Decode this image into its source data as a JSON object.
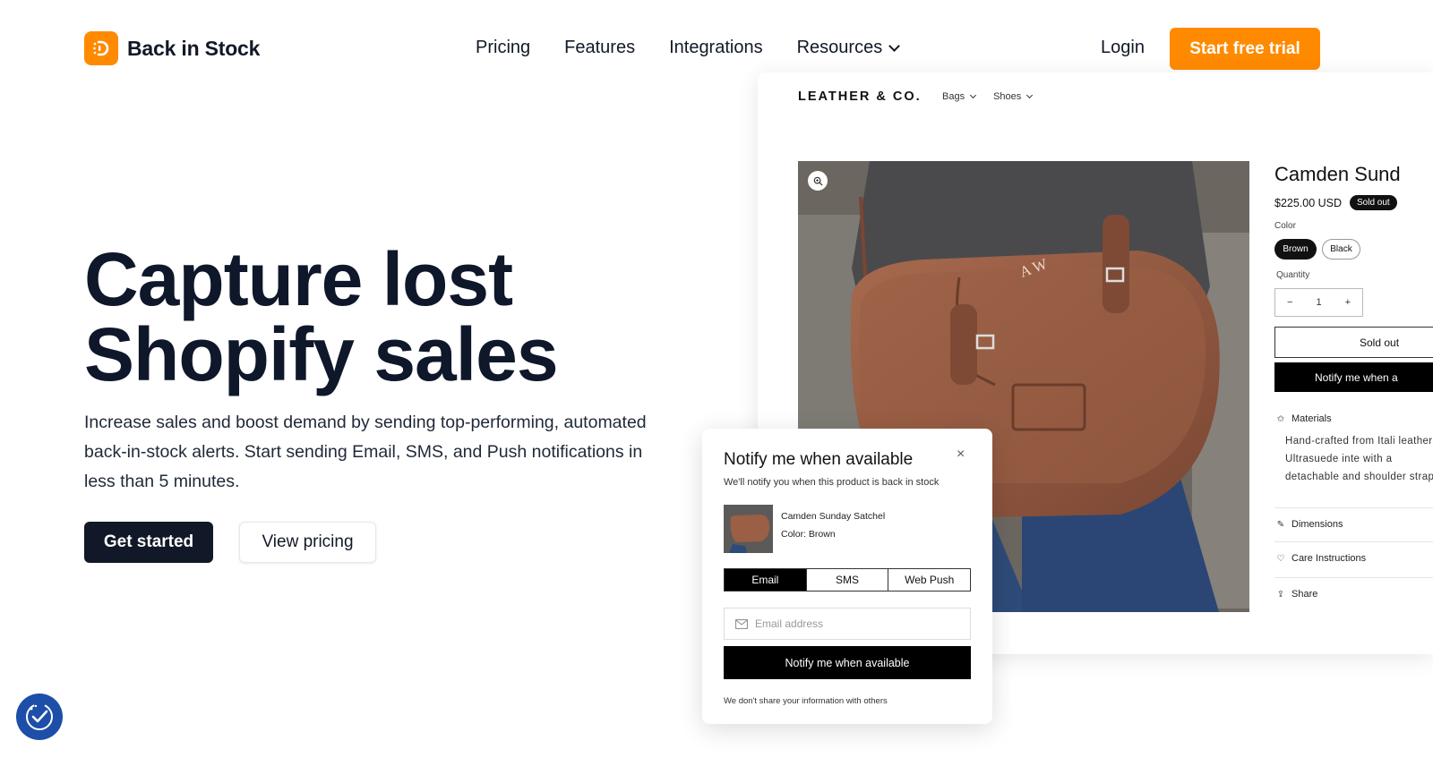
{
  "header": {
    "brand": "Back in Stock",
    "nav": [
      "Pricing",
      "Features",
      "Integrations",
      "Resources"
    ],
    "login": "Login",
    "cta": "Start free trial"
  },
  "hero": {
    "title_line1": "Capture lost",
    "title_line2": "Shopify sales",
    "description": "Increase sales and boost demand by sending top-performing, automated back-in-stock alerts. Start sending Email, SMS, and Push notifications in less than 5 minutes.",
    "primary_button": "Get started",
    "secondary_button": "View pricing"
  },
  "store": {
    "brand": "LEATHER & CO.",
    "nav": [
      "Bags",
      "Shoes"
    ],
    "product": {
      "title": "Camden Sund",
      "price": "$225.00 USD",
      "badge": "Sold out",
      "color_label": "Color",
      "colors": [
        "Brown",
        "Black"
      ],
      "quantity_label": "Quantity",
      "quantity": "1",
      "minus": "−",
      "plus": "+",
      "soldout_button": "Sold out",
      "notify_button": "Notify me when a",
      "monogram": "A W",
      "accordions": {
        "materials": "Materials",
        "materials_text": "Hand-crafted from Itali leather. Ultrasuede inte with a detachable and shoulder strap.",
        "dimensions": "Dimensions",
        "care": "Care Instructions",
        "share": "Share"
      }
    }
  },
  "popup": {
    "title": "Notify me when available",
    "subtitle": "We'll notify you when this product is back in stock",
    "close": "×",
    "product_name": "Camden Sunday Satchel",
    "product_color": "Color: Brown",
    "tabs": [
      "Email",
      "SMS",
      "Web Push"
    ],
    "active_tab": "Email",
    "email_placeholder": "Email address",
    "button": "Notify me when available",
    "privacy": "We don't share your information with others"
  },
  "colors": {
    "brand_orange": "#ff8a00",
    "dark": "#111827",
    "accessibility_blue": "#1d4ea8"
  },
  "icons": [
    "logo-icon",
    "chevron-down-icon",
    "zoom-icon",
    "materials-icon",
    "ruler-icon",
    "heart-icon",
    "share-icon",
    "close-icon",
    "mail-icon",
    "accessibility-icon"
  ]
}
